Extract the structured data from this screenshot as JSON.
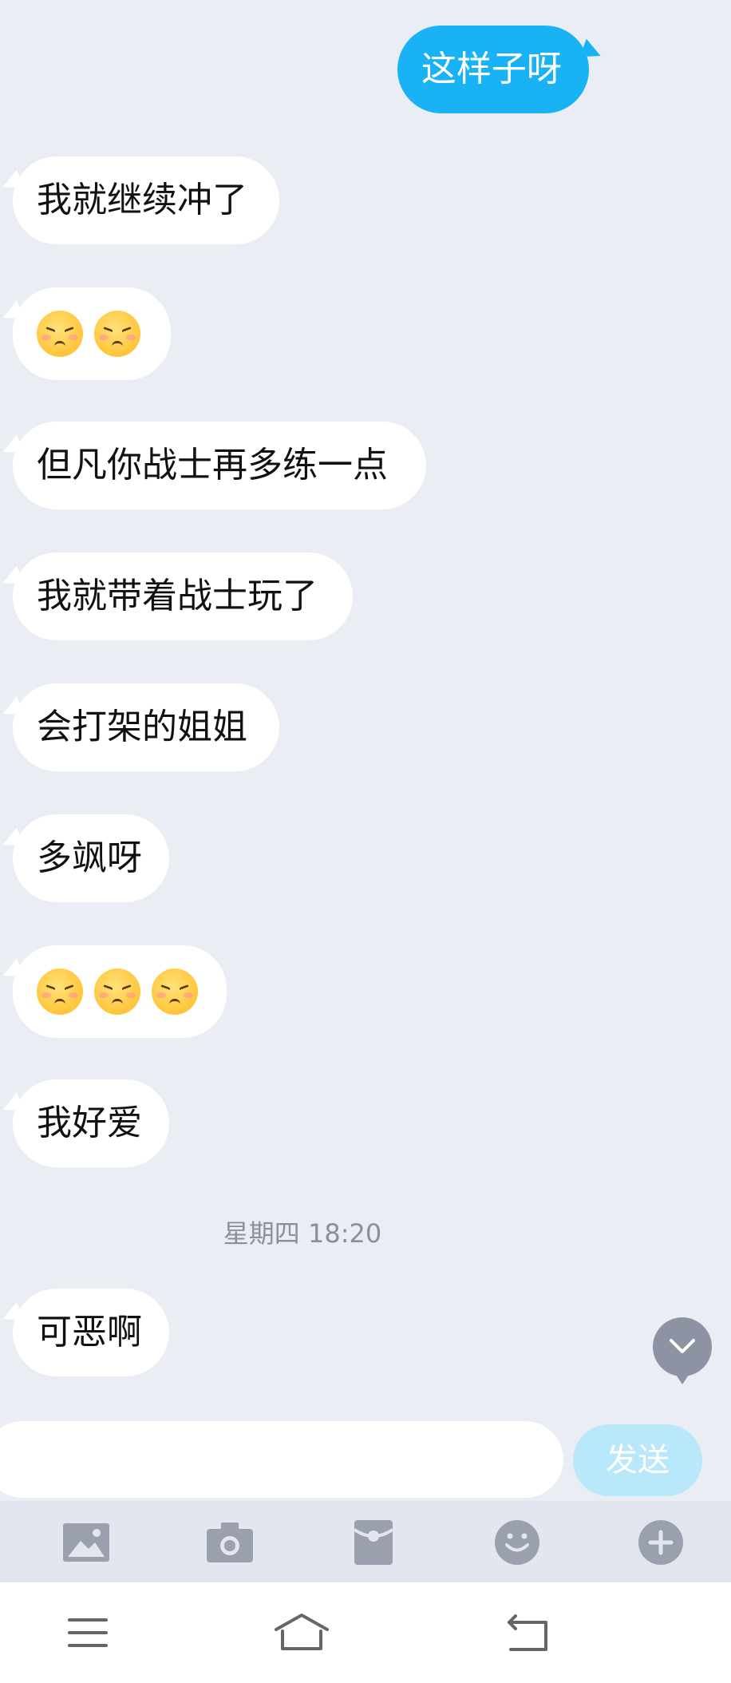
{
  "messages": [
    {
      "side": "right",
      "type": "text",
      "text": "这样子呀"
    },
    {
      "side": "left",
      "type": "text",
      "text": "我就继续冲了"
    },
    {
      "side": "left",
      "type": "emoji",
      "count": 2,
      "emoji": "squint-smile-face"
    },
    {
      "side": "left",
      "type": "text",
      "text": "但凡你战士再多练一点"
    },
    {
      "side": "left",
      "type": "text",
      "text": "我就带着战士玩了"
    },
    {
      "side": "left",
      "type": "text",
      "text": "会打架的姐姐"
    },
    {
      "side": "left",
      "type": "text",
      "text": "多飒呀"
    },
    {
      "side": "left",
      "type": "emoji",
      "count": 3,
      "emoji": "squint-smile-face"
    },
    {
      "side": "left",
      "type": "text",
      "text": "我好爱"
    },
    {
      "side": "left",
      "type": "text",
      "text": "可恶啊"
    }
  ],
  "timestamp": "星期四 18:20",
  "input": {
    "value": "",
    "placeholder": ""
  },
  "send_label": "发送",
  "toolbar": [
    "image-icon",
    "camera-icon",
    "red-packet-icon",
    "emoji-icon",
    "plus-icon"
  ],
  "nav": [
    "menu-icon",
    "home-icon",
    "back-icon"
  ],
  "colors": {
    "background": "#ebedf5",
    "outgoing_bubble": "#19b2f5",
    "incoming_bubble": "#ffffff",
    "send_button": "#b9e8fb",
    "icon_gray": "#9aa0ae"
  }
}
